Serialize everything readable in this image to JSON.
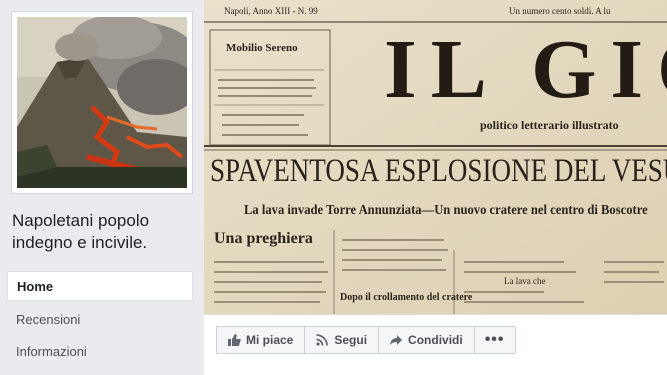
{
  "page": {
    "name": "Napoletani popolo indegno e incivile."
  },
  "nav": {
    "items": [
      {
        "label": "Home",
        "active": true
      },
      {
        "label": "Recensioni",
        "active": false
      },
      {
        "label": "Informazioni",
        "active": false
      }
    ]
  },
  "cover": {
    "header_left": "Napoli, Anno XIII - N. 99",
    "header_right": "Un numero cento soldi. A lu",
    "masthead": "IL GIO",
    "subtitle": "politico letterario illustrato",
    "headline": "SPAVENTOSA ESPLOSIONE DEL VESUVIO",
    "subheadline": "La lava invade Torre Annunziata—Un nuovo cratere nel centro di Boscotre",
    "side_title": "Una preghiera",
    "caption": "Dopo il crollamento del cratere",
    "caption2": "La lava che",
    "ad_title": "Mobilio Sereno"
  },
  "actions": {
    "like": {
      "label": "Mi piace",
      "icon": "thumbs-up-icon"
    },
    "follow": {
      "label": "Segui",
      "icon": "rss-icon"
    },
    "share": {
      "label": "Condividi",
      "icon": "share-arrow-icon"
    },
    "more": {
      "label": "•••",
      "icon": "more-dots-icon"
    }
  },
  "colors": {
    "background": "#e9ebee",
    "text": "#1d2129",
    "nav_text": "#4b4f56",
    "button_bg": "#f5f6f7",
    "paper": "#e6dcc4"
  }
}
